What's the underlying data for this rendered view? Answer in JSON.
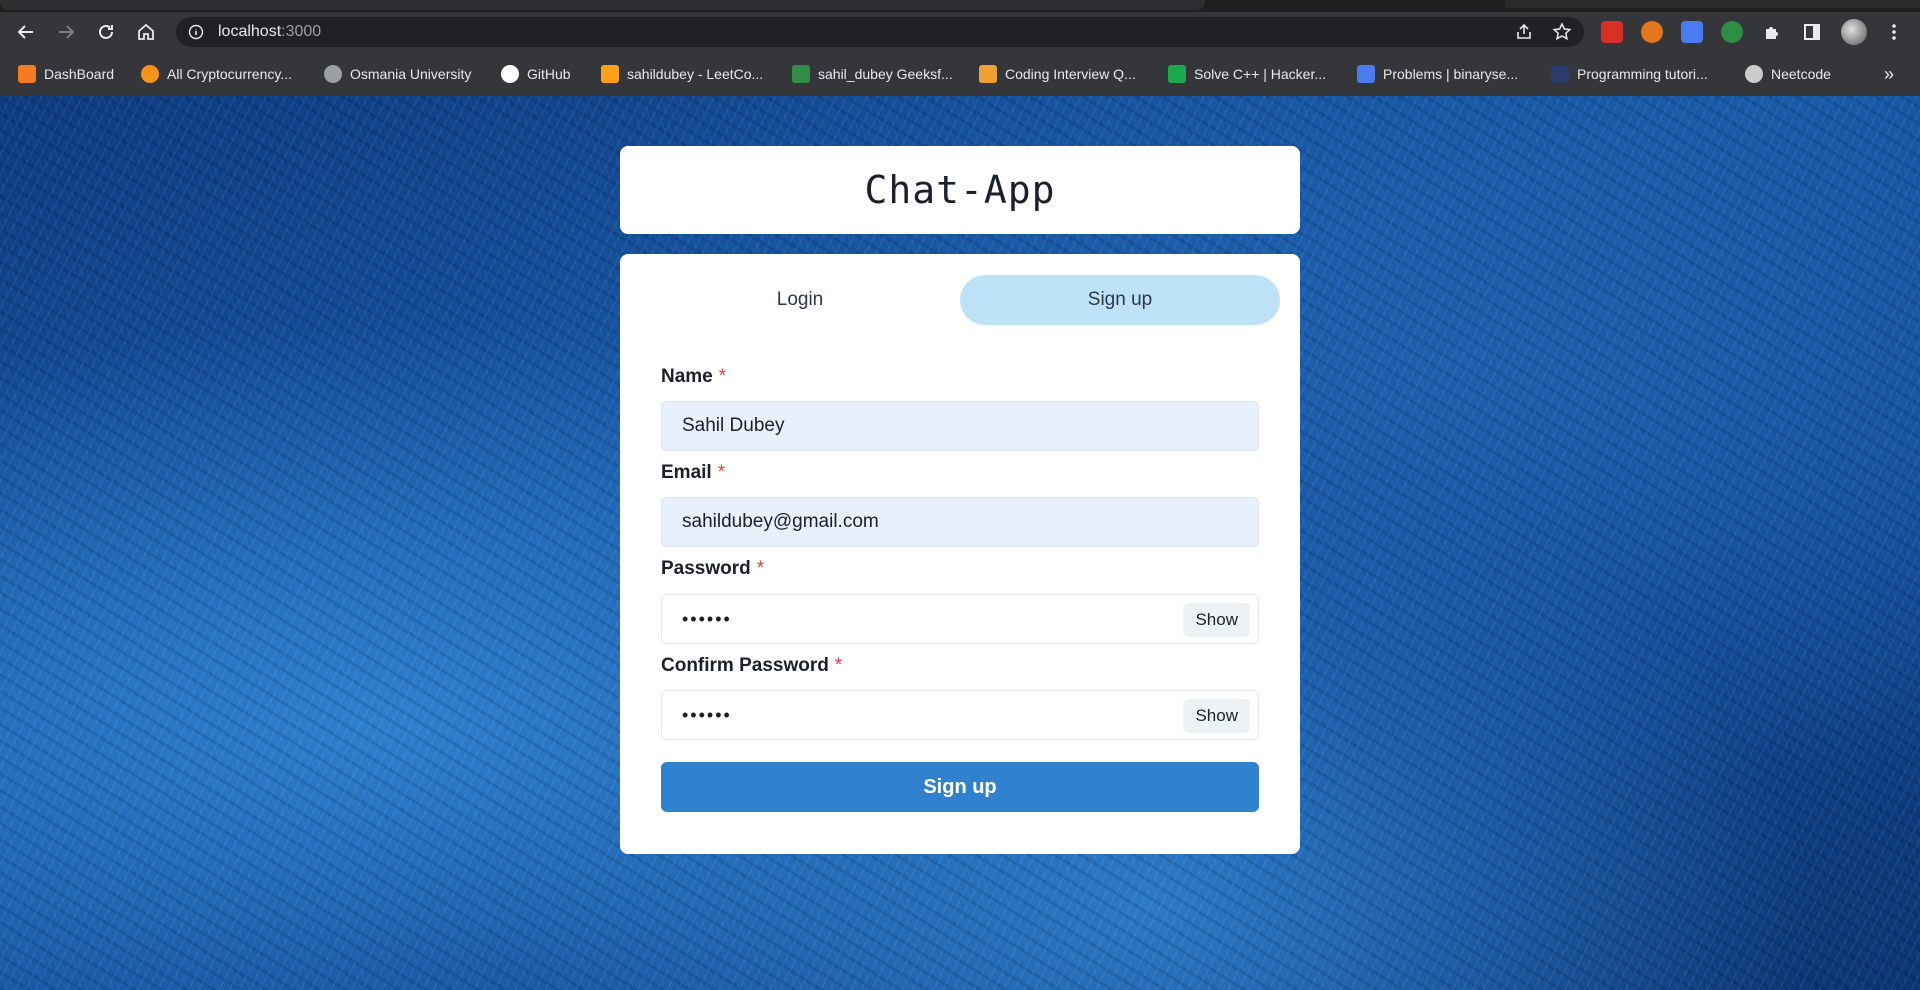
{
  "browser": {
    "url_host": "localhost",
    "url_port": ":3000",
    "bookmarks": [
      {
        "label": "DashBoard",
        "color": "#f47b20"
      },
      {
        "label": "All Cryptocurrency...",
        "color": "#f7931a"
      },
      {
        "label": "Osmania University",
        "color": "#9aa0a6"
      },
      {
        "label": "GitHub",
        "color": "#ffffff"
      },
      {
        "label": "sahildubey - LeetCo...",
        "color": "#ffa116"
      },
      {
        "label": "sahil_dubey Geeksf...",
        "color": "#2f8d46"
      },
      {
        "label": "Coding Interview Q...",
        "color": "#f0a030"
      },
      {
        "label": "Solve C++ | Hacker...",
        "color": "#1ba94c"
      },
      {
        "label": "Problems | binaryse...",
        "color": "#4a7cf0"
      },
      {
        "label": "Programming tutori...",
        "color": "#2a3b6e"
      },
      {
        "label": "Neetcode",
        "color": "#cccccc"
      }
    ],
    "overflow": "»"
  },
  "app": {
    "title": "Chat-App",
    "tabs": {
      "login": "Login",
      "signup": "Sign up"
    },
    "form": {
      "name_label": "Name",
      "name_value": "Sahil Dubey",
      "email_label": "Email",
      "email_value": "sahildubey@gmail.com",
      "password_label": "Password",
      "password_value": "••••••",
      "confirm_label": "Confirm Password",
      "confirm_value": "••••••",
      "required_mark": "*",
      "show_label": "Show",
      "submit_label": "Sign up"
    }
  },
  "colors": {
    "accent": "#3182ce",
    "selected_tab": "#bee3f8",
    "required": "#e53e3e"
  }
}
